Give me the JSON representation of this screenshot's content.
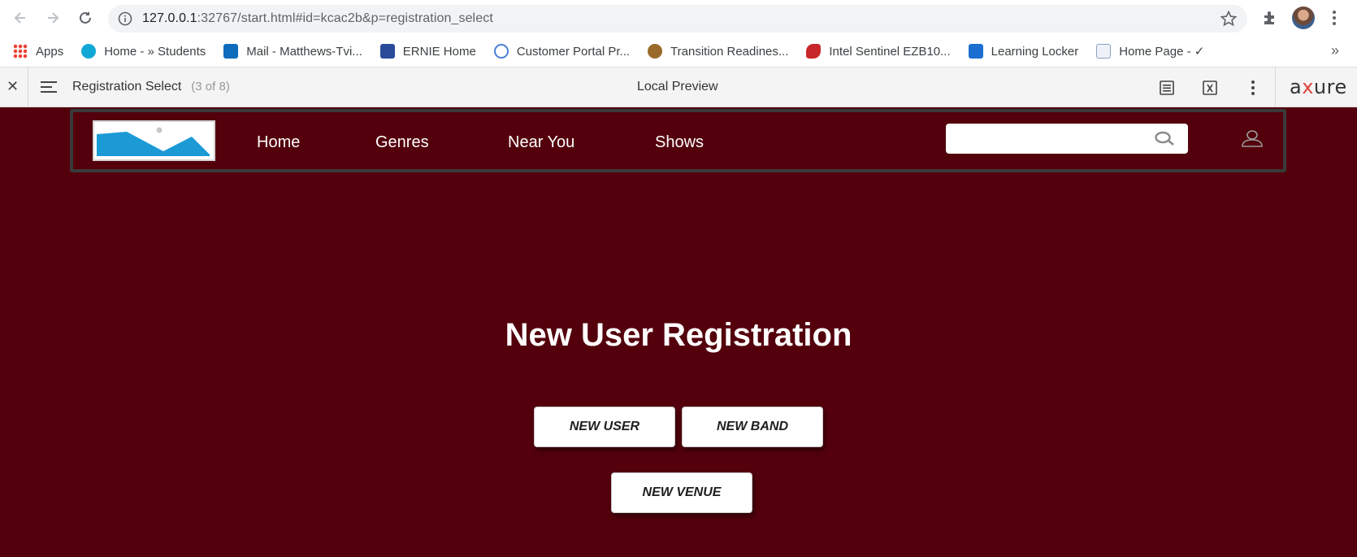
{
  "browser": {
    "url_host": "127.0.0.1",
    "url_rest": ":32767/start.html#id=kcac2b&p=registration_select",
    "icons": [
      "back-icon",
      "forward-icon",
      "reload-icon",
      "info-icon",
      "star-icon",
      "extensions-icon",
      "menu-icon"
    ]
  },
  "bookmarks": [
    {
      "label": "Apps",
      "color": "#ea4335"
    },
    {
      "label": "Home - » Students",
      "color": "#12a8d6"
    },
    {
      "label": "Mail - Matthews-Tvi...",
      "color": "#0f6cbd"
    },
    {
      "label": "ERNIE Home",
      "color": "#2a4a9a"
    },
    {
      "label": "Customer Portal Pr...",
      "color": "#4a7fd6"
    },
    {
      "label": "Transition Readines...",
      "color": "#9a6a2a"
    },
    {
      "label": "Intel Sentinel EZB10...",
      "color": "#c8282a"
    },
    {
      "label": "Learning Locker",
      "color": "#1a6fd0"
    },
    {
      "label": "Home Page - ✓",
      "color": "#8aa0c0"
    }
  ],
  "bookmarks_more": "»",
  "axure": {
    "page_name": "Registration Select",
    "page_count": "(3 of 8)",
    "preview_title": "Local Preview",
    "logo_a": "a",
    "logo_x": "x",
    "logo_rest": "ure"
  },
  "site": {
    "nav": [
      "Home",
      "Genres",
      "Near You",
      "Shows"
    ],
    "search_placeholder": "",
    "bg_color": "#53000c"
  },
  "main": {
    "title": "New User Registration",
    "buttons": {
      "new_user": "NEW USER",
      "new_band": "NEW BAND",
      "new_venue": "NEW VENUE"
    }
  }
}
